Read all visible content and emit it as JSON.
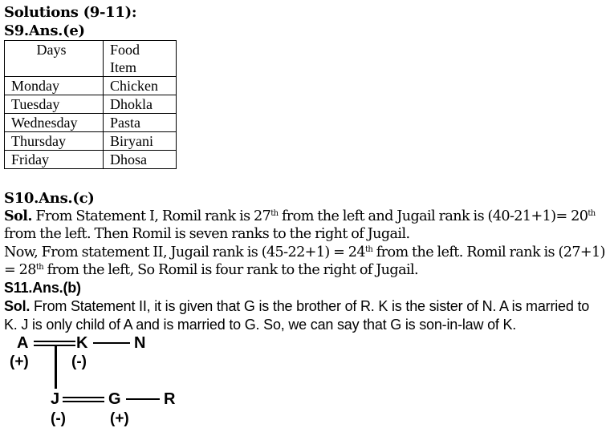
{
  "title": "Solutions (9-11):",
  "s9": {
    "answer": "S9.Ans.(e)",
    "table": {
      "headers": [
        "Days",
        "Food",
        "Item"
      ],
      "rows": [
        [
          "Monday",
          "Chicken"
        ],
        [
          "Tuesday",
          "Dhokla"
        ],
        [
          "Wednesday",
          "Pasta"
        ],
        [
          "Thursday",
          "Biryani"
        ],
        [
          "Friday",
          "Dhosa"
        ]
      ]
    }
  },
  "s10": {
    "answer": "S10.Ans.(c)",
    "sol_label": "Sol.",
    "p1a": " From Statement I, Romil rank is 27",
    "sup1": "th",
    "p1b": " from the left and Jugail rank is (40-21+1)= 20",
    "sup2": "th",
    "p1c": " from the left. Then Romil is seven ranks to the right of Jugail.",
    "p2a": "Now, From statement II, Jugail rank is (45-22+1) = 24",
    "sup3": "th",
    "p2b": " from the left. Romil rank is (27+1) = 28",
    "sup4": "th",
    "p2c": " from the left, So Romil is four rank to the right of Jugail."
  },
  "s11": {
    "answer": "S11.Ans.(b)",
    "sol_label": "Sol.",
    "text": " From Statement II, it is given that G is the brother of R. K is the sister of N. A is married to K. J is only child of A and is married to G. So, we can say that G is son-in-law of K.",
    "tree": {
      "nodes": {
        "A": "A",
        "K": "K",
        "N": "N",
        "J": "J",
        "G": "G",
        "R": "R"
      },
      "signs": {
        "A": "(+)",
        "K": "(-)",
        "J": "(-)",
        "G": "(+)"
      }
    }
  }
}
